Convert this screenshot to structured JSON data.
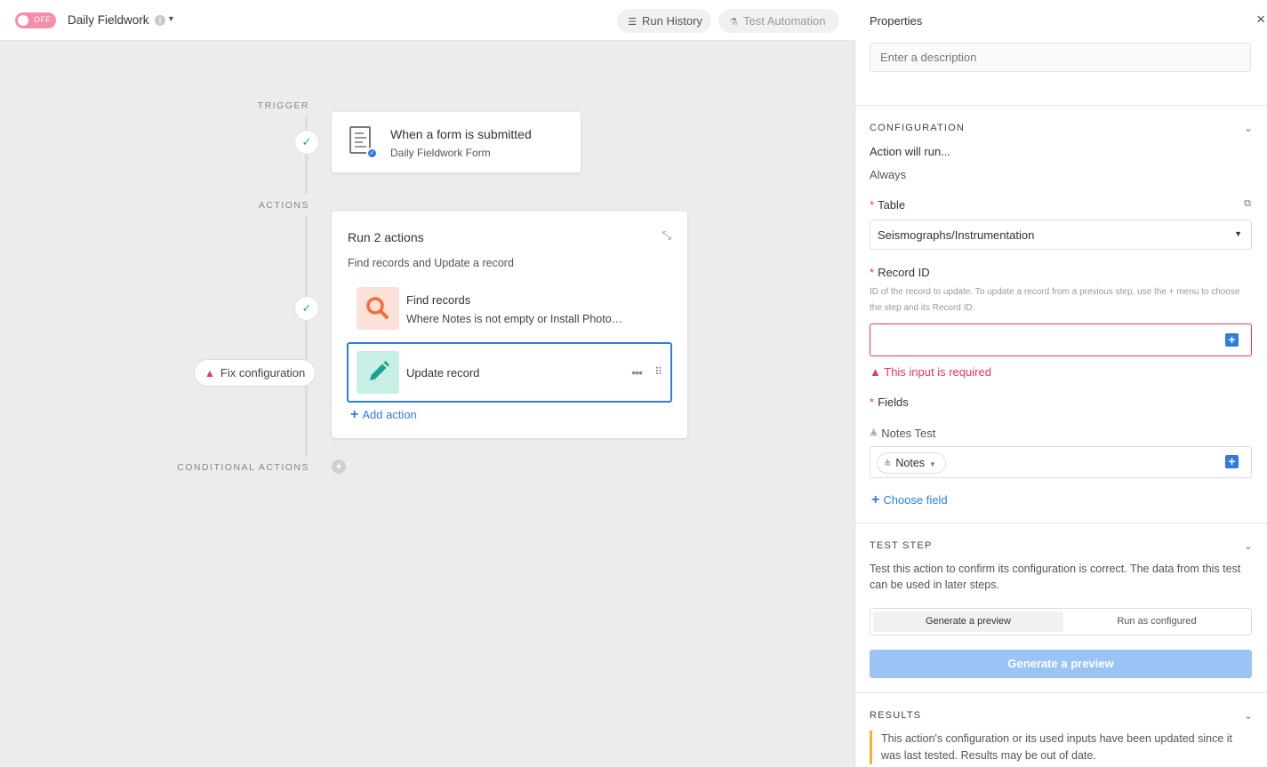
{
  "topbar": {
    "toggle_label": "OFF",
    "automation_name": "Daily Fieldwork",
    "run_history_label": "Run History",
    "test_automation_label": "Test Automation"
  },
  "canvas": {
    "trigger_label": "TRIGGER",
    "actions_label": "ACTIONS",
    "conditional_label": "CONDITIONAL ACTIONS",
    "trigger_card": {
      "title": "When a form is submitted",
      "subtitle": "Daily Fieldwork Form"
    },
    "actions_card": {
      "title": "Run 2 actions",
      "subtitle": "Find records and Update a record",
      "steps": [
        {
          "title": "Find records",
          "subtitle": "Where Notes is not empty or Install Photo…"
        },
        {
          "title": "Update record"
        }
      ],
      "add_action_label": "Add action"
    },
    "fix_config_label": "Fix configuration"
  },
  "panel": {
    "header": "Properties",
    "description_placeholder": "Enter a description",
    "configuration": {
      "title": "CONFIGURATION",
      "action_will_run_label": "Action will run...",
      "action_will_run_value": "Always",
      "table_label": "Table",
      "table_value": "Seismographs/Instrumentation",
      "record_id_label": "Record ID",
      "record_id_desc": "ID of the record to update. To update a record from a previous step, use the + menu to choose the step and its Record ID.",
      "error_text": "This input is required",
      "fields_label": "Fields",
      "field_name": "Notes Test",
      "field_chip": "Notes",
      "choose_field_label": "Choose field"
    },
    "test_step": {
      "title": "TEST STEP",
      "text": "Test this action to confirm its configuration is correct. The data from this test can be used in later steps.",
      "seg_left": "Generate a preview",
      "seg_right": "Run as configured",
      "button": "Generate a preview"
    },
    "results": {
      "title": "RESULTS",
      "note": "This action's configuration or its used inputs have been updated since it was last tested. Results may be out of date."
    }
  },
  "colors": {
    "accent": "#2f7de1",
    "error": "#e5385f",
    "toggle_off": "#f58fa7",
    "warning_bar": "#f7b02f",
    "success": "#2cb34a"
  }
}
